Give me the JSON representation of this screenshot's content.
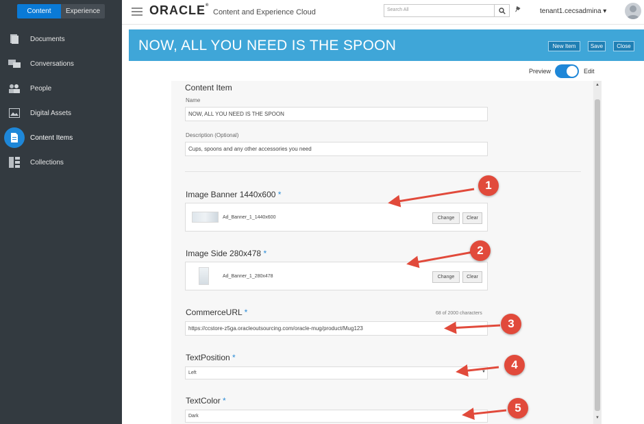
{
  "sidebar": {
    "tabs": [
      "Content",
      "Experience"
    ],
    "items": [
      {
        "label": "Documents",
        "icon": "documents-icon"
      },
      {
        "label": "Conversations",
        "icon": "conversations-icon"
      },
      {
        "label": "People",
        "icon": "people-icon"
      },
      {
        "label": "Digital Assets",
        "icon": "digital-assets-icon"
      },
      {
        "label": "Content Items",
        "icon": "content-items-icon",
        "active": true
      },
      {
        "label": "Collections",
        "icon": "collections-icon"
      }
    ]
  },
  "header": {
    "logo": "ORACLE",
    "app_name": "Content and Experience Cloud",
    "search_placeholder": "Search All",
    "user": "tenant1.cecsadmina ▾"
  },
  "titlebar": {
    "title": "NOW, ALL YOU NEED IS THE SPOON",
    "new_item": "New Item",
    "save": "Save",
    "close": "Close"
  },
  "toggle": {
    "preview": "Preview",
    "edit": "Edit",
    "state": "on"
  },
  "form": {
    "section_title": "Content Item",
    "name_label": "Name",
    "name_value": "NOW, ALL YOU NEED IS THE SPOON",
    "description_label": "Description (Optional)",
    "description_value": "Cups, spoons and any other accessories you need",
    "image_banner_label": "Image Banner 1440x600",
    "image_banner_file": "Ad_Banner_1_1440x600",
    "image_side_label": "Image Side 280x478",
    "image_side_file": "Ad_Banner_1_280x478",
    "change": "Change",
    "clear": "Clear",
    "commerce_label": "CommerceURL",
    "commerce_count": "68 of 2000 characters",
    "commerce_value": "https://ccstore-z5ga.oracleoutsourcing.com/oracle-mug/product/Mug123",
    "textposition_label": "TextPosition",
    "textposition_value": "Left",
    "textcolor_label": "TextColor",
    "textcolor_value": "Dark",
    "required_mark": "*"
  },
  "callouts": [
    "1",
    "2",
    "3",
    "4",
    "5"
  ],
  "colors": {
    "accent": "#3fa6d8",
    "sidebar": "#333a40",
    "active": "#1e87d8",
    "callout": "#e14a3b"
  }
}
